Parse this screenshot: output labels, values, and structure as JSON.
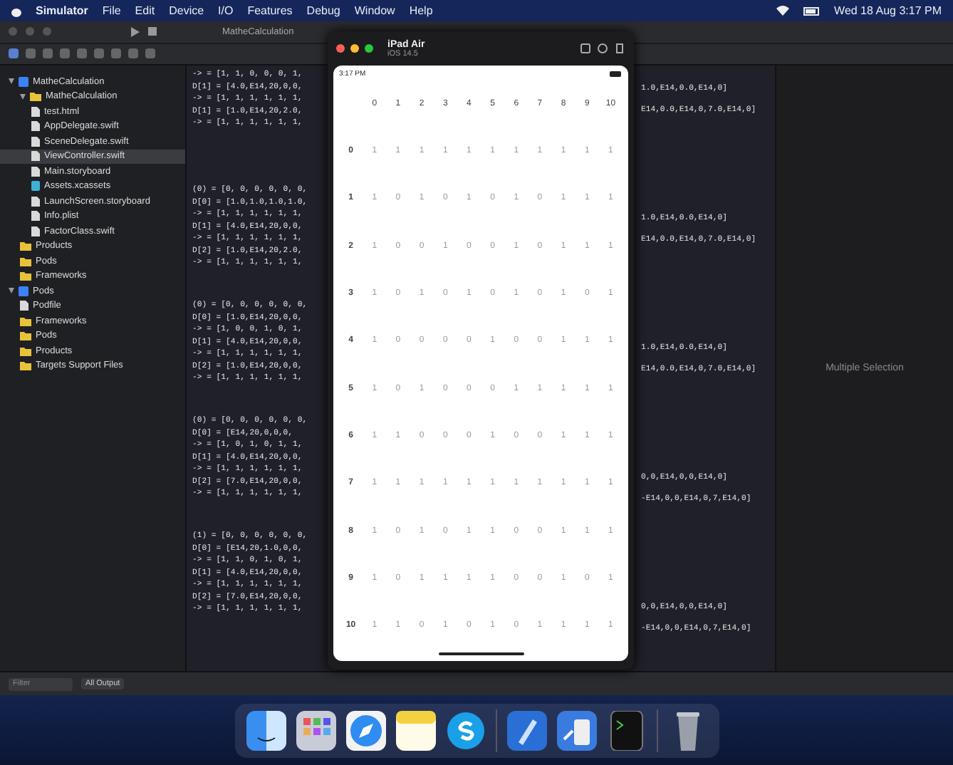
{
  "menu_bar": {
    "app_name": "Simulator",
    "items": [
      "File",
      "Edit",
      "Device",
      "I/O",
      "Features",
      "Debug",
      "Window",
      "Help"
    ],
    "clock": "Wed 18 Aug 3:17 PM"
  },
  "toolbar": {
    "scheme": "MatheCalculation"
  },
  "navigator": {
    "items": [
      {
        "label": "MatheCalculation",
        "kind": "project",
        "selected": false,
        "children": [
          {
            "label": "MatheCalculation",
            "kind": "folder",
            "selected": false,
            "children": [
              {
                "label": "test.html",
                "kind": "file",
                "selected": false
              },
              {
                "label": "AppDelegate.swift",
                "kind": "file",
                "selected": false
              },
              {
                "label": "SceneDelegate.swift",
                "kind": "file",
                "selected": false
              },
              {
                "label": "ViewController.swift",
                "kind": "file",
                "selected": true
              },
              {
                "label": "Main.storyboard",
                "kind": "file",
                "selected": false
              },
              {
                "label": "Assets.xcassets",
                "kind": "assets",
                "selected": false
              },
              {
                "label": "LaunchScreen.storyboard",
                "kind": "file",
                "selected": false
              },
              {
                "label": "Info.plist",
                "kind": "file",
                "selected": false
              },
              {
                "label": "FactorClass.swift",
                "kind": "file",
                "selected": false
              }
            ]
          },
          {
            "label": "Products",
            "kind": "folder",
            "selected": false
          },
          {
            "label": "Pods",
            "kind": "folder",
            "selected": false
          },
          {
            "label": "Frameworks",
            "kind": "folder",
            "selected": false
          }
        ]
      },
      {
        "label": "Pods",
        "kind": "project",
        "selected": false,
        "children": [
          {
            "label": "Podfile",
            "kind": "file",
            "selected": false
          },
          {
            "label": "Frameworks",
            "kind": "folder",
            "selected": false
          },
          {
            "label": "Pods",
            "kind": "folder",
            "selected": false
          },
          {
            "label": "Products",
            "kind": "folder",
            "selected": false
          },
          {
            "label": "Targets Support Files",
            "kind": "folder",
            "selected": false
          }
        ]
      }
    ]
  },
  "editor": {
    "blocks": [
      {
        "lines": [
          "-> = [1, 1, 0, 0, 0, 1,",
          "D[1] = [4.0,E14,20,0,0,",
          "-> = [1, 1, 1, 1, 1, 1,",
          "D[1] = [1.0,E14,20,2.0,",
          "-> = [1, 1, 1, 1, 1, 1,"
        ],
        "tail": [
          "1.0,E14,0.0,E14,0]",
          "E14,0.0,E14,0,7.0,E14,0]"
        ]
      },
      {
        "lines": [
          "(0) = [0, 0, 0, 0, 0, 0,",
          "D[0] = [1.0,1.0,1.0,1.0,",
          "-> = [1, 1, 1, 1, 1, 1,",
          "D[1] = [4.0,E14,20,0,0,",
          "-> = [1, 1, 1, 1, 1, 1,",
          "D[2] = [1.0,E14,20,2.0,",
          "-> = [1, 1, 1, 1, 1, 1,"
        ],
        "tail": [
          "1.0,E14,0.0,E14,0]",
          "E14,0.0,E14,0,7.0,E14,0]"
        ]
      },
      {
        "lines": [
          "(0) = [0, 0, 0, 0, 0, 0,",
          "D[0] = [1.0,E14,20,0,0,",
          "-> = [1, 0, 0, 1, 0, 1,",
          "D[1] = [4.0,E14,20,0,0,",
          "-> = [1, 1, 1, 1, 1, 1,",
          "D[2] = [1.0,E14,20,0,0,",
          "-> = [1, 1, 1, 1, 1, 1,"
        ],
        "tail": [
          "1.0,E14,0.0,E14,0]",
          "E14,0.0,E14,0,7.0,E14,0]"
        ]
      },
      {
        "lines": [
          "(0) = [0, 0, 0, 0, 0, 0,",
          "D[0] = [E14,20,0,0,0,",
          "-> = [1, 0, 1, 0, 1, 1,",
          "D[1] = [4.0,E14,20,0,0,",
          "-> = [1, 1, 1, 1, 1, 1,",
          "D[2] = [7.0,E14,20,0,0,",
          "-> = [1, 1, 1, 1, 1, 1,"
        ],
        "tail": [
          "0,0,E14,0,0,E14,0]",
          "-E14,0,0,E14,0,7,E14,0]"
        ]
      },
      {
        "lines": [
          "(1) = [0, 0, 0, 0, 0, 0,",
          "D[0] = [E14,20,1.0,0,0,",
          "-> = [1, 1, 0, 1, 0, 1,",
          "D[1] = [4.0,E14,20,0,0,",
          "-> = [1, 1, 1, 1, 1, 1,",
          "D[2] = [7.0,E14,20,0,0,",
          "-> = [1, 1, 1, 1, 1, 1,"
        ],
        "tail": [
          "0,0,E14,0,0,E14,0]",
          "-E14,0,0,E14,0,7,E14,0]"
        ]
      }
    ]
  },
  "inspector": {
    "message": "Multiple Selection"
  },
  "filter": {
    "placeholder": "Filter"
  },
  "scope": "All Output",
  "simulator": {
    "title": "iPad Air",
    "subtitle": "iOS 14.5",
    "status_time": "3:17 PM",
    "columns": [
      "0",
      "1",
      "2",
      "3",
      "4",
      "5",
      "6",
      "7",
      "8",
      "9",
      "10"
    ],
    "rows": [
      {
        "label": "0",
        "cells": [
          "1",
          "1",
          "1",
          "1",
          "1",
          "1",
          "1",
          "1",
          "1",
          "1",
          "1"
        ]
      },
      {
        "label": "1",
        "cells": [
          "1",
          "0",
          "1",
          "0",
          "1",
          "0",
          "1",
          "0",
          "1",
          "1",
          "1"
        ]
      },
      {
        "label": "2",
        "cells": [
          "1",
          "0",
          "0",
          "1",
          "0",
          "0",
          "1",
          "0",
          "1",
          "1",
          "1"
        ]
      },
      {
        "label": "3",
        "cells": [
          "1",
          "0",
          "1",
          "0",
          "1",
          "0",
          "1",
          "0",
          "1",
          "0",
          "1"
        ]
      },
      {
        "label": "4",
        "cells": [
          "1",
          "0",
          "0",
          "0",
          "0",
          "1",
          "0",
          "0",
          "1",
          "1",
          "1"
        ]
      },
      {
        "label": "5",
        "cells": [
          "1",
          "0",
          "1",
          "0",
          "0",
          "0",
          "1",
          "1",
          "1",
          "1",
          "1"
        ]
      },
      {
        "label": "6",
        "cells": [
          "1",
          "1",
          "0",
          "0",
          "0",
          "1",
          "0",
          "0",
          "1",
          "1",
          "1"
        ]
      },
      {
        "label": "7",
        "cells": [
          "1",
          "1",
          "1",
          "1",
          "1",
          "1",
          "1",
          "1",
          "1",
          "1",
          "1"
        ]
      },
      {
        "label": "8",
        "cells": [
          "1",
          "0",
          "1",
          "0",
          "1",
          "1",
          "0",
          "0",
          "1",
          "1",
          "1"
        ]
      },
      {
        "label": "9",
        "cells": [
          "1",
          "0",
          "1",
          "1",
          "1",
          "1",
          "0",
          "0",
          "1",
          "0",
          "1"
        ]
      },
      {
        "label": "10",
        "cells": [
          "1",
          "1",
          "0",
          "1",
          "0",
          "1",
          "0",
          "1",
          "1",
          "1",
          "1"
        ]
      }
    ]
  },
  "dock": {
    "apps": [
      {
        "kind": "finder"
      },
      {
        "kind": "launchpad"
      },
      {
        "kind": "safari"
      },
      {
        "kind": "notes"
      },
      {
        "kind": "skype"
      },
      {
        "kind": "divider"
      },
      {
        "kind": "xcode"
      },
      {
        "kind": "simulator"
      },
      {
        "kind": "terminal"
      },
      {
        "kind": "divider"
      },
      {
        "kind": "trash"
      }
    ]
  }
}
